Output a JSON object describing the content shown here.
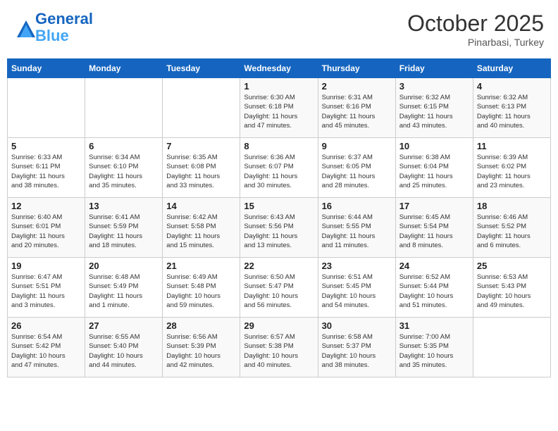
{
  "header": {
    "logo_line1": "General",
    "logo_line2": "Blue",
    "month": "October 2025",
    "location": "Pinarbasi, Turkey"
  },
  "weekdays": [
    "Sunday",
    "Monday",
    "Tuesday",
    "Wednesday",
    "Thursday",
    "Friday",
    "Saturday"
  ],
  "weeks": [
    [
      {
        "day": "",
        "info": ""
      },
      {
        "day": "",
        "info": ""
      },
      {
        "day": "",
        "info": ""
      },
      {
        "day": "1",
        "info": "Sunrise: 6:30 AM\nSunset: 6:18 PM\nDaylight: 11 hours\nand 47 minutes."
      },
      {
        "day": "2",
        "info": "Sunrise: 6:31 AM\nSunset: 6:16 PM\nDaylight: 11 hours\nand 45 minutes."
      },
      {
        "day": "3",
        "info": "Sunrise: 6:32 AM\nSunset: 6:15 PM\nDaylight: 11 hours\nand 43 minutes."
      },
      {
        "day": "4",
        "info": "Sunrise: 6:32 AM\nSunset: 6:13 PM\nDaylight: 11 hours\nand 40 minutes."
      }
    ],
    [
      {
        "day": "5",
        "info": "Sunrise: 6:33 AM\nSunset: 6:11 PM\nDaylight: 11 hours\nand 38 minutes."
      },
      {
        "day": "6",
        "info": "Sunrise: 6:34 AM\nSunset: 6:10 PM\nDaylight: 11 hours\nand 35 minutes."
      },
      {
        "day": "7",
        "info": "Sunrise: 6:35 AM\nSunset: 6:08 PM\nDaylight: 11 hours\nand 33 minutes."
      },
      {
        "day": "8",
        "info": "Sunrise: 6:36 AM\nSunset: 6:07 PM\nDaylight: 11 hours\nand 30 minutes."
      },
      {
        "day": "9",
        "info": "Sunrise: 6:37 AM\nSunset: 6:05 PM\nDaylight: 11 hours\nand 28 minutes."
      },
      {
        "day": "10",
        "info": "Sunrise: 6:38 AM\nSunset: 6:04 PM\nDaylight: 11 hours\nand 25 minutes."
      },
      {
        "day": "11",
        "info": "Sunrise: 6:39 AM\nSunset: 6:02 PM\nDaylight: 11 hours\nand 23 minutes."
      }
    ],
    [
      {
        "day": "12",
        "info": "Sunrise: 6:40 AM\nSunset: 6:01 PM\nDaylight: 11 hours\nand 20 minutes."
      },
      {
        "day": "13",
        "info": "Sunrise: 6:41 AM\nSunset: 5:59 PM\nDaylight: 11 hours\nand 18 minutes."
      },
      {
        "day": "14",
        "info": "Sunrise: 6:42 AM\nSunset: 5:58 PM\nDaylight: 11 hours\nand 15 minutes."
      },
      {
        "day": "15",
        "info": "Sunrise: 6:43 AM\nSunset: 5:56 PM\nDaylight: 11 hours\nand 13 minutes."
      },
      {
        "day": "16",
        "info": "Sunrise: 6:44 AM\nSunset: 5:55 PM\nDaylight: 11 hours\nand 11 minutes."
      },
      {
        "day": "17",
        "info": "Sunrise: 6:45 AM\nSunset: 5:54 PM\nDaylight: 11 hours\nand 8 minutes."
      },
      {
        "day": "18",
        "info": "Sunrise: 6:46 AM\nSunset: 5:52 PM\nDaylight: 11 hours\nand 6 minutes."
      }
    ],
    [
      {
        "day": "19",
        "info": "Sunrise: 6:47 AM\nSunset: 5:51 PM\nDaylight: 11 hours\nand 3 minutes."
      },
      {
        "day": "20",
        "info": "Sunrise: 6:48 AM\nSunset: 5:49 PM\nDaylight: 11 hours\nand 1 minute."
      },
      {
        "day": "21",
        "info": "Sunrise: 6:49 AM\nSunset: 5:48 PM\nDaylight: 10 hours\nand 59 minutes."
      },
      {
        "day": "22",
        "info": "Sunrise: 6:50 AM\nSunset: 5:47 PM\nDaylight: 10 hours\nand 56 minutes."
      },
      {
        "day": "23",
        "info": "Sunrise: 6:51 AM\nSunset: 5:45 PM\nDaylight: 10 hours\nand 54 minutes."
      },
      {
        "day": "24",
        "info": "Sunrise: 6:52 AM\nSunset: 5:44 PM\nDaylight: 10 hours\nand 51 minutes."
      },
      {
        "day": "25",
        "info": "Sunrise: 6:53 AM\nSunset: 5:43 PM\nDaylight: 10 hours\nand 49 minutes."
      }
    ],
    [
      {
        "day": "26",
        "info": "Sunrise: 6:54 AM\nSunset: 5:42 PM\nDaylight: 10 hours\nand 47 minutes."
      },
      {
        "day": "27",
        "info": "Sunrise: 6:55 AM\nSunset: 5:40 PM\nDaylight: 10 hours\nand 44 minutes."
      },
      {
        "day": "28",
        "info": "Sunrise: 6:56 AM\nSunset: 5:39 PM\nDaylight: 10 hours\nand 42 minutes."
      },
      {
        "day": "29",
        "info": "Sunrise: 6:57 AM\nSunset: 5:38 PM\nDaylight: 10 hours\nand 40 minutes."
      },
      {
        "day": "30",
        "info": "Sunrise: 6:58 AM\nSunset: 5:37 PM\nDaylight: 10 hours\nand 38 minutes."
      },
      {
        "day": "31",
        "info": "Sunrise: 7:00 AM\nSunset: 5:35 PM\nDaylight: 10 hours\nand 35 minutes."
      },
      {
        "day": "",
        "info": ""
      }
    ]
  ]
}
